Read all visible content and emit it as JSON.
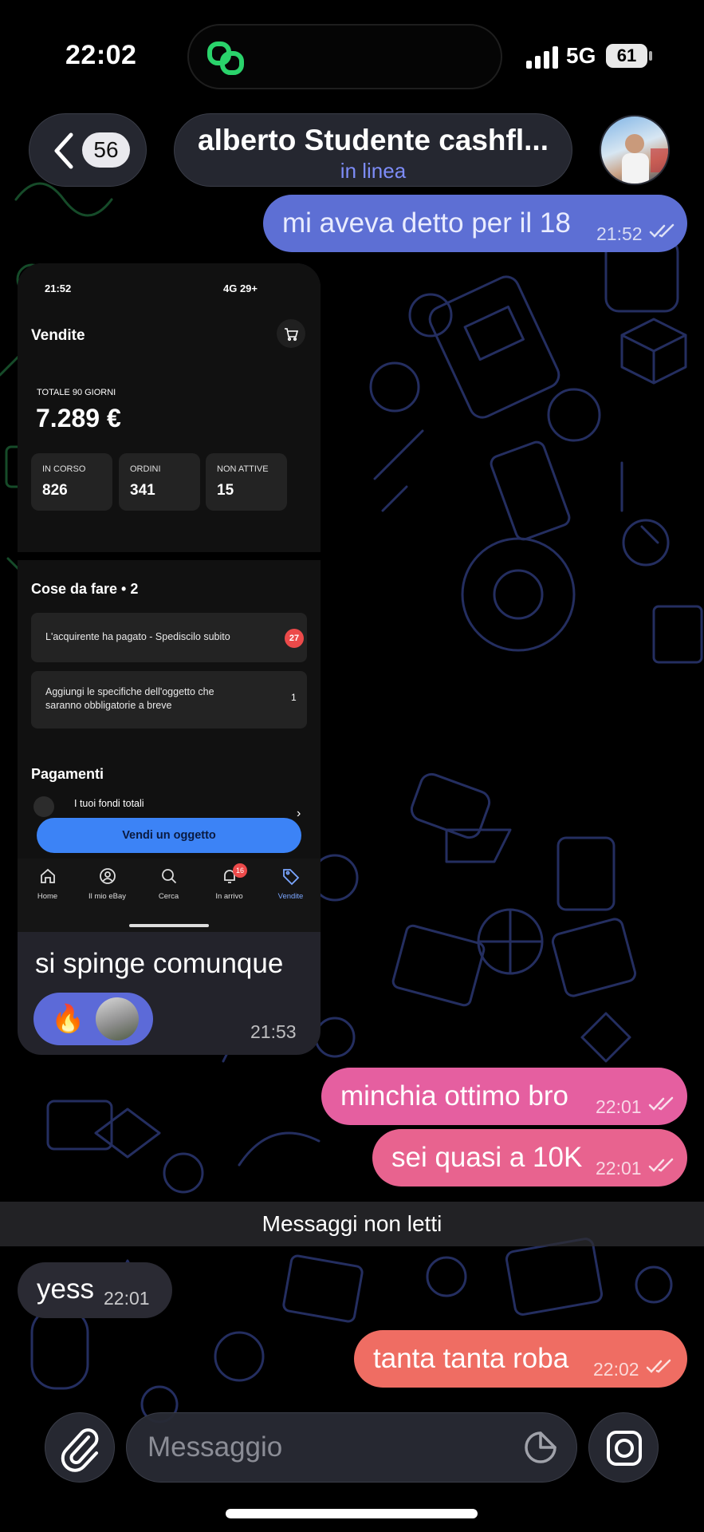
{
  "status_bar": {
    "time": "22:02",
    "network": "5G",
    "battery": "61"
  },
  "header": {
    "back_count": "56",
    "title": "alberto Studente cashfl...",
    "status": "in linea"
  },
  "messages": {
    "m1": {
      "text": "mi aveva detto per il 18",
      "time": "21:52"
    },
    "media": {
      "caption": "si spinge comunque",
      "time": "21:53",
      "reaction_emoji": "🔥"
    },
    "m3": {
      "text": "minchia ottimo bro",
      "time": "22:01"
    },
    "m4": {
      "text": "sei quasi a 10K",
      "time": "22:01"
    },
    "unread_label": "Messaggi non letti",
    "m5": {
      "text": "yess",
      "time": "22:01"
    },
    "m6": {
      "text": "tanta tanta roba",
      "time": "22:02"
    }
  },
  "ebay_screenshot": {
    "status_time": "21:52",
    "status_right": "4G 29+",
    "title": "Vendite",
    "total_label": "TOTALE 90 GIORNI",
    "total_value": "7.289 €",
    "stats": [
      {
        "label": "IN CORSO",
        "value": "826"
      },
      {
        "label": "ORDINI",
        "value": "341"
      },
      {
        "label": "NON ATTIVE",
        "value": "15"
      }
    ],
    "todo_title": "Cose da fare • 2",
    "todos": [
      {
        "text": "L'acquirente ha pagato - Spediscilo subito",
        "count": "27"
      },
      {
        "text": "Aggiungi le specifiche dell'oggetto che saranno obbligatorie a breve",
        "count": "1"
      }
    ],
    "payments_title": "Pagamenti",
    "payments_item": "I tuoi fondi totali",
    "sell_button": "Vendi un oggetto",
    "nav": [
      {
        "label": "Home"
      },
      {
        "label": "Il mio eBay"
      },
      {
        "label": "Cerca"
      },
      {
        "label": "In arrivo",
        "badge": "16"
      },
      {
        "label": "Vendite"
      }
    ]
  },
  "composer": {
    "placeholder": "Messaggio"
  },
  "colors": {
    "accent": "#7d8cf7",
    "bubble_blue": "#5d6fd4",
    "bubble_pink": "#e55fa0",
    "bubble_coral": "#ef6d63",
    "ebay_blue": "#3c83f6"
  },
  "icons": [
    "back-chevron-icon",
    "attach-icon",
    "sticker-icon",
    "camera-icon",
    "double-check-icon"
  ]
}
